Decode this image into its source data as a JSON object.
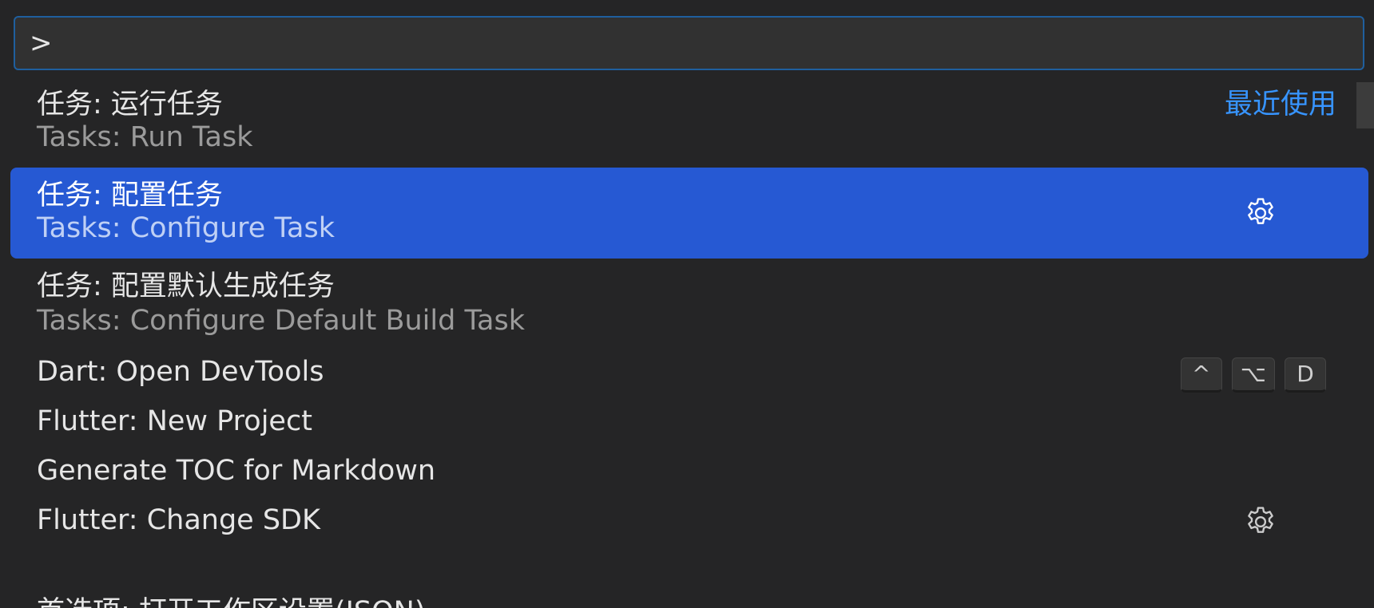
{
  "input": {
    "value": ">",
    "placeholder": ""
  },
  "items": [
    {
      "label": "任务: 运行任务",
      "detail": "Tasks: Run Task",
      "badge": "最近使用"
    },
    {
      "label": "任务: 配置任务",
      "detail": "Tasks: Configure Task",
      "icon": "gear-icon",
      "selected": true
    },
    {
      "label": "任务: 配置默认生成任务",
      "detail": "Tasks: Configure Default Build Task"
    },
    {
      "label": "Dart: Open DevTools",
      "keys": [
        "^",
        "⌥",
        "D"
      ]
    },
    {
      "label": "Flutter: New Project"
    },
    {
      "label": "Generate TOC for Markdown"
    },
    {
      "label": "Flutter: Change SDK",
      "icon": "gear-icon"
    },
    {
      "label": "首选项: 打开工作区设置(JSON)"
    }
  ],
  "colors": {
    "background": "#252526",
    "selection": "#2659d3",
    "accent": "#3794ff",
    "input_border": "#1f5f9e"
  }
}
